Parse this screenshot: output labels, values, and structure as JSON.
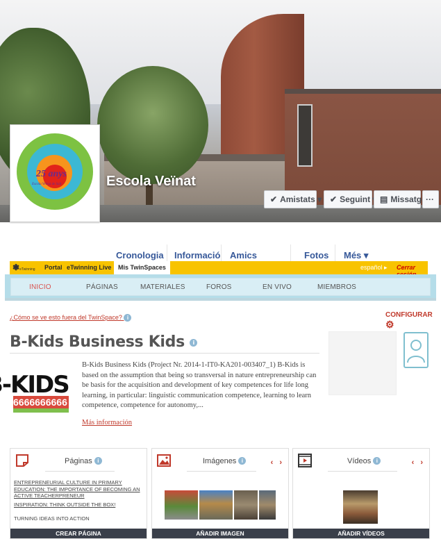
{
  "profile": {
    "name": "Escola Veïnat",
    "logo_text": "25 anys",
    "logo_subtext": "Escola Veïnat de Salt"
  },
  "cover_buttons": {
    "friends": "Amistats ▾",
    "following": "Seguint ▾",
    "message": "Missatge",
    "more": "···"
  },
  "timeline_tabs": [
    "Cronologia",
    "Informació",
    "Amics",
    "Fotos",
    "Més ▾"
  ],
  "etwinning_bar": {
    "logo": "eTwinning",
    "items": [
      "Portal",
      "eTwinning Live",
      "Mis TwinSpaces"
    ],
    "language": "español ▸",
    "logout": "Cerrar sesión"
  },
  "twinspace_menu": [
    "INICIO",
    "PÁGINAS",
    "MATERIALES",
    "FOROS",
    "EN VIVO",
    "MIEMBROS"
  ],
  "content": {
    "outside_link": "¿Cómo se ve esto fuera del TwinSpace?",
    "configure": "CONFIGURAR",
    "project_title": "B-Kids Business Kids",
    "description": "B-Kids Business Kids (Project Nr. 2014-1-IT0-KA201-003407_1) B-Kids is based on the assumption that being so transversal in nature entrepreneurship can be basis for the acquisition and development of key competences for life long learning, in particular: linguistic communication competence, learning to learn competence, competence for autonomy,...",
    "more_info": "Más información",
    "bkids_logo_top": "B-KIDS",
    "bkids_logo_stripe": "6666666666"
  },
  "cards": {
    "pages": {
      "title": "Páginas",
      "links": [
        "ENTREPRENEURIAL CULTURE IN PRIMARY EDUCATION: THE IMPORTANCE OF BECOMING AN ACTIVE TEACHERPRENEUR",
        "INSPIRATION: THINK OUTSIDE THE BOX!",
        "TURNING IDEAS INTO ACTION"
      ],
      "button": "CREAR PÁGINA"
    },
    "images": {
      "title": "Imágenes",
      "arrows": "‹ ›",
      "button": "AÑADIR IMAGEN"
    },
    "videos": {
      "title": "Vídeos",
      "arrows": "‹ ›",
      "button": "AÑADIR VÍDEOS"
    }
  },
  "colors": {
    "etwinning_yellow": "#f8c300",
    "accent_red": "#c0392b",
    "menu_blue": "#b5dde9",
    "facebook_link": "#365899"
  }
}
